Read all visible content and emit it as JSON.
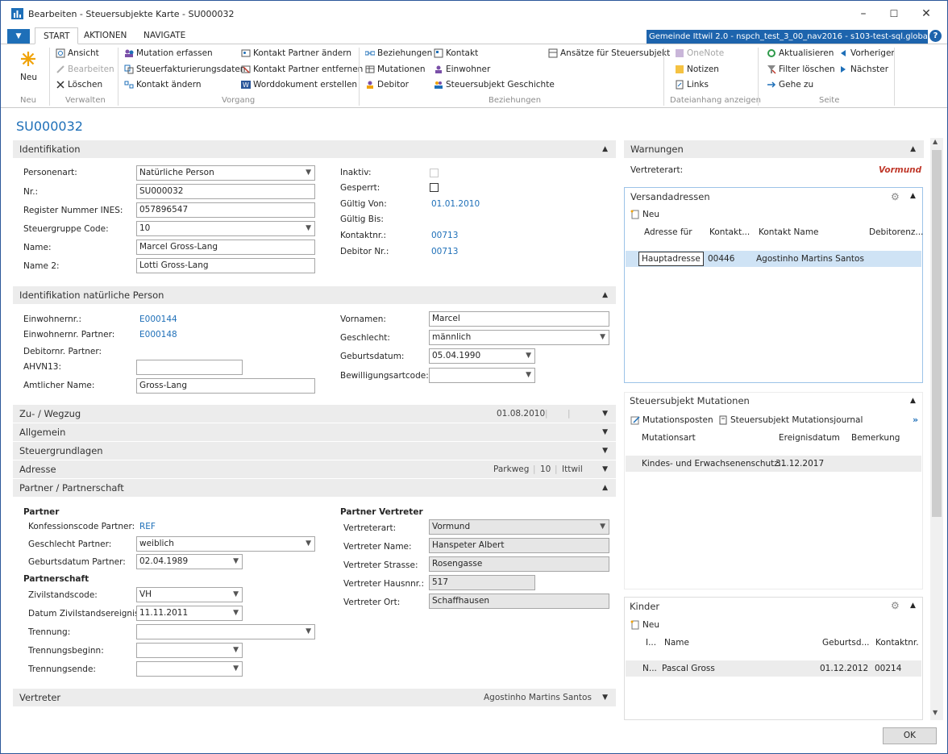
{
  "window": {
    "title": "Bearbeiten - Steuersubjekte Karte - SU000032",
    "minimize": "–",
    "maximize": "☐",
    "close": "✕"
  },
  "tabs": {
    "menu": "▼",
    "start": "START",
    "aktionen": "AKTIONEN",
    "navigate": "NAVIGATE"
  },
  "env": "Gemeinde Ittwil 2.0 - nspch_test_3_00_nav2016 - s103-test-sql.global.fum",
  "help": "?",
  "ribbon": {
    "neu": "Neu",
    "ansicht": "Ansicht",
    "bearbeiten": "Bearbeiten",
    "loeschen": "Löschen",
    "mutation_erfassen": "Mutation erfassen",
    "steuerfakturierungsdaten": "Steuerfakturierungsdaten",
    "kontakt_aendern": "Kontakt ändern",
    "kontakt_partner_aendern": "Kontakt Partner ändern",
    "kontakt_partner_entfernen": "Kontakt Partner entfernen",
    "worddokument": "Worddokument erstellen",
    "beziehungen": "Beziehungen",
    "mutationen": "Mutationen",
    "debitor": "Debitor",
    "kontakt": "Kontakt",
    "einwohner": "Einwohner",
    "geschichte": "Steuersubjekt Geschichte",
    "ansaetze": "Ansätze für Steuersubjekt",
    "onenote": "OneNote",
    "notizen": "Notizen",
    "links": "Links",
    "aktualisieren": "Aktualisieren",
    "filter_loeschen": "Filter löschen",
    "gehe_zu": "Gehe zu",
    "vorheriger": "Vorheriger",
    "naechster": "Nächster",
    "groups": {
      "neu": "Neu",
      "verwalten": "Verwalten",
      "vorgang": "Vorgang",
      "beziehungen": "Beziehungen",
      "dateianhang": "Dateianhang anzeigen",
      "seite": "Seite"
    }
  },
  "record_id": "SU000032",
  "identifikation": {
    "title": "Identifikation",
    "personenart_l": "Personenart:",
    "personenart": "Natürliche Person",
    "nr_l": "Nr.:",
    "nr": "SU000032",
    "ines_l": "Register Nummer INES:",
    "ines": "057896547",
    "sg_l": "Steuergruppe Code:",
    "sg": "10",
    "name_l": "Name:",
    "name": "Marcel Gross-Lang",
    "name2_l": "Name 2:",
    "name2": "Lotti Gross-Lang",
    "inaktiv_l": "Inaktiv:",
    "gesperrt_l": "Gesperrt:",
    "gvon_l": "Gültig Von:",
    "gvon": "01.01.2010",
    "gbis_l": "Gültig Bis:",
    "kontaktnr_l": "Kontaktnr.:",
    "kontaktnr": "00713",
    "debitornr_l": "Debitor Nr.:",
    "debitornr": "00713"
  },
  "natuerlich": {
    "title": "Identifikation natürliche Person",
    "einwohnernr_l": "Einwohnernr.:",
    "einwohnernr": "E000144",
    "einwohnernr_p_l": "Einwohnernr. Partner:",
    "einwohnernr_p": "E000148",
    "debitornr_p_l": "Debitornr. Partner:",
    "ahvn13_l": "AHVN13:",
    "ahvn13": "",
    "amtl_l": "Amtlicher Name:",
    "amtl": "Gross-Lang",
    "vornamen_l": "Vornamen:",
    "vornamen": "Marcel",
    "geschlecht_l": "Geschlecht:",
    "geschlecht": "männlich",
    "geburtsdatum_l": "Geburtsdatum:",
    "geburtsdatum": "05.04.1990",
    "bewilligung_l": "Bewilligungsartcode:",
    "bewilligung": ""
  },
  "zuwegzug": {
    "title": "Zu- / Wegzug",
    "date": "01.08.2010"
  },
  "allgemein": {
    "title": "Allgemein"
  },
  "steuergrundlagen": {
    "title": "Steuergrundlagen"
  },
  "adresse": {
    "title": "Adresse",
    "strasse": "Parkweg",
    "nr": "10",
    "ort": "Ittwil"
  },
  "partner": {
    "title": "Partner / Partnerschaft",
    "partner_h": "Partner",
    "konf_l": "Konfessionscode Partner:",
    "konf": "REF",
    "geschl_l": "Geschlecht Partner:",
    "geschl": "weiblich",
    "geb_l": "Geburtsdatum Partner:",
    "geb": "02.04.1989",
    "partnerschaft_h": "Partnerschaft",
    "zivil_l": "Zivilstandscode:",
    "zivil": "VH",
    "datum_zivil_l": "Datum Zivilstandsereignis:",
    "datum_zivil": "11.11.2011",
    "trennung_l": "Trennung:",
    "trennung": "",
    "tbeginn_l": "Trennungsbeginn:",
    "tbeginn": "",
    "tende_l": "Trennungsende:",
    "tende": "",
    "vertreter_h": "Partner Vertreter",
    "vart_l": "Vertreterart:",
    "vart": "Vormund",
    "vname_l": "Vertreter Name:",
    "vname": "Hanspeter Albert",
    "vstr_l": "Vertreter Strasse:",
    "vstr": "Rosengasse",
    "vhnr_l": "Vertreter Hausnnr.:",
    "vhnr": "517",
    "vort_l": "Vertreter Ort:",
    "vort": "Schaffhausen"
  },
  "vertreter": {
    "title": "Vertreter",
    "summary": "Agostinho Martins Santos"
  },
  "warnungen": {
    "title": "Warnungen",
    "label": "Vertreterart:",
    "value": "Vormund"
  },
  "versand": {
    "title": "Versandadressen",
    "neu": "Neu",
    "cols": [
      "Adresse für",
      "Kontakt...",
      "Kontakt Name",
      "Debitorenz..."
    ],
    "rows": [
      {
        "adresse": "Hauptadresse",
        "kontakt": "00446",
        "name": "Agostinho Martins Santos",
        "debitor": ""
      }
    ]
  },
  "mutationen": {
    "title": "Steuersubjekt Mutationen",
    "posten": "Mutationsposten",
    "journal": "Steuersubjekt Mutationsjournal",
    "more": "»",
    "cols": [
      "Mutationsart",
      "Ereignisdatum",
      "Bemerkung"
    ],
    "rows": [
      {
        "art": "Kindes- und Erwachsenenschutz...",
        "datum": "31.12.2017",
        "bem": ""
      }
    ]
  },
  "kinder": {
    "title": "Kinder",
    "neu": "Neu",
    "cols": [
      "I...",
      "Name",
      "Geburtsd...",
      "Kontaktnr."
    ],
    "rows": [
      {
        "i": "N...",
        "name": "Pascal Gross",
        "geb": "01.12.2012",
        "kontakt": "00214"
      }
    ]
  },
  "ok": "OK",
  "colors": {
    "accent": "#1e6fb8",
    "warning": "#c0392b",
    "selected_row": "#cfe3f5"
  }
}
